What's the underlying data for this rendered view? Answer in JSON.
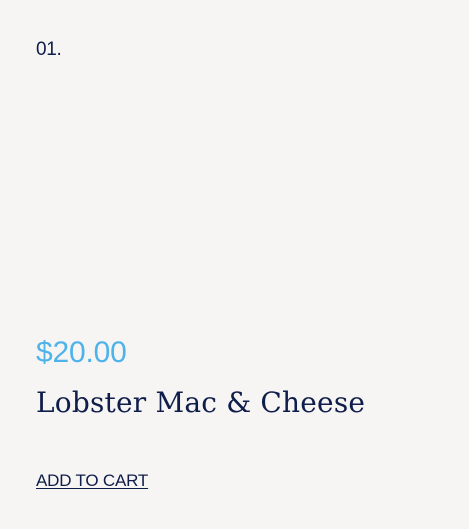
{
  "product": {
    "number": "01.",
    "price": "$20.00",
    "name": "Lobster Mac & Cheese",
    "add_to_cart_label": "ADD TO CART"
  },
  "colors": {
    "background": "#f7f5f3",
    "price_accent": "#4eb3ea",
    "text_navy": "#0f1d4a"
  }
}
